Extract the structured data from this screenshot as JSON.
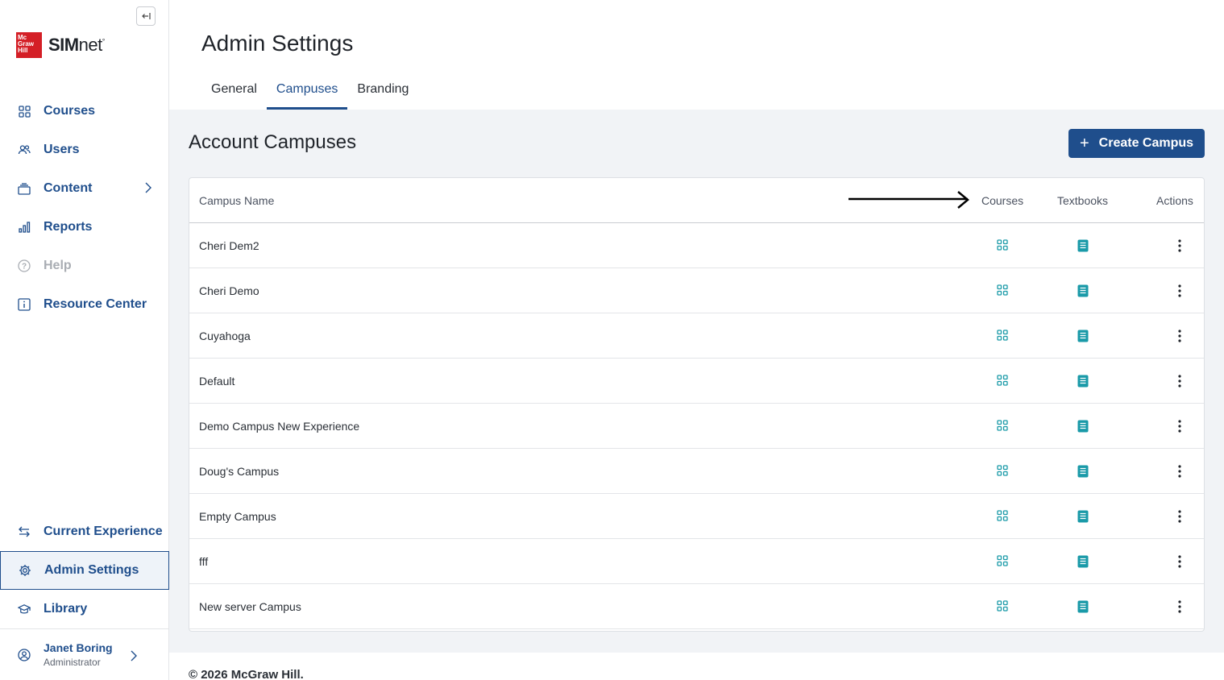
{
  "sidebar": {
    "brand_box": [
      "Mc",
      "Graw",
      "Hill"
    ],
    "brand_bold": "SIM",
    "brand_rest": "net",
    "brand_mark": "°",
    "items": [
      {
        "label": "Courses",
        "icon": "grid-icon"
      },
      {
        "label": "Users",
        "icon": "users-icon"
      },
      {
        "label": "Content",
        "icon": "stack-icon"
      },
      {
        "label": "Reports",
        "icon": "bar-chart-icon"
      },
      {
        "label": "Help",
        "icon": "help-icon"
      },
      {
        "label": "Resource Center",
        "icon": "info-icon"
      }
    ],
    "bottom_items": [
      {
        "label": "Current Experience",
        "icon": "swap-icon"
      },
      {
        "label": "Admin Settings",
        "icon": "gear-icon"
      },
      {
        "label": "Library",
        "icon": "graduation-cap-icon"
      }
    ],
    "user": {
      "name": "Janet Boring",
      "role": "Administrator"
    }
  },
  "header": {
    "title": "Admin Settings",
    "tabs": [
      "General",
      "Campuses",
      "Branding"
    ],
    "active_tab": "Campuses"
  },
  "content": {
    "title": "Account Campuses",
    "create_button": "Create Campus",
    "columns": {
      "name": "Campus Name",
      "courses": "Courses",
      "textbooks": "Textbooks",
      "actions": "Actions"
    },
    "rows": [
      "Cheri Dem2",
      "Cheri Demo",
      "Cuyahoga",
      "Default",
      "Demo Campus New Experience",
      "Doug's Campus",
      "Empty Campus",
      "fff",
      "New server Campus"
    ]
  },
  "footer": {
    "copyright": "© 2026 McGraw Hill."
  },
  "colors": {
    "primary": "#1f4e8c",
    "teal": "#1a9aa8",
    "brand_red": "#d41f26"
  }
}
